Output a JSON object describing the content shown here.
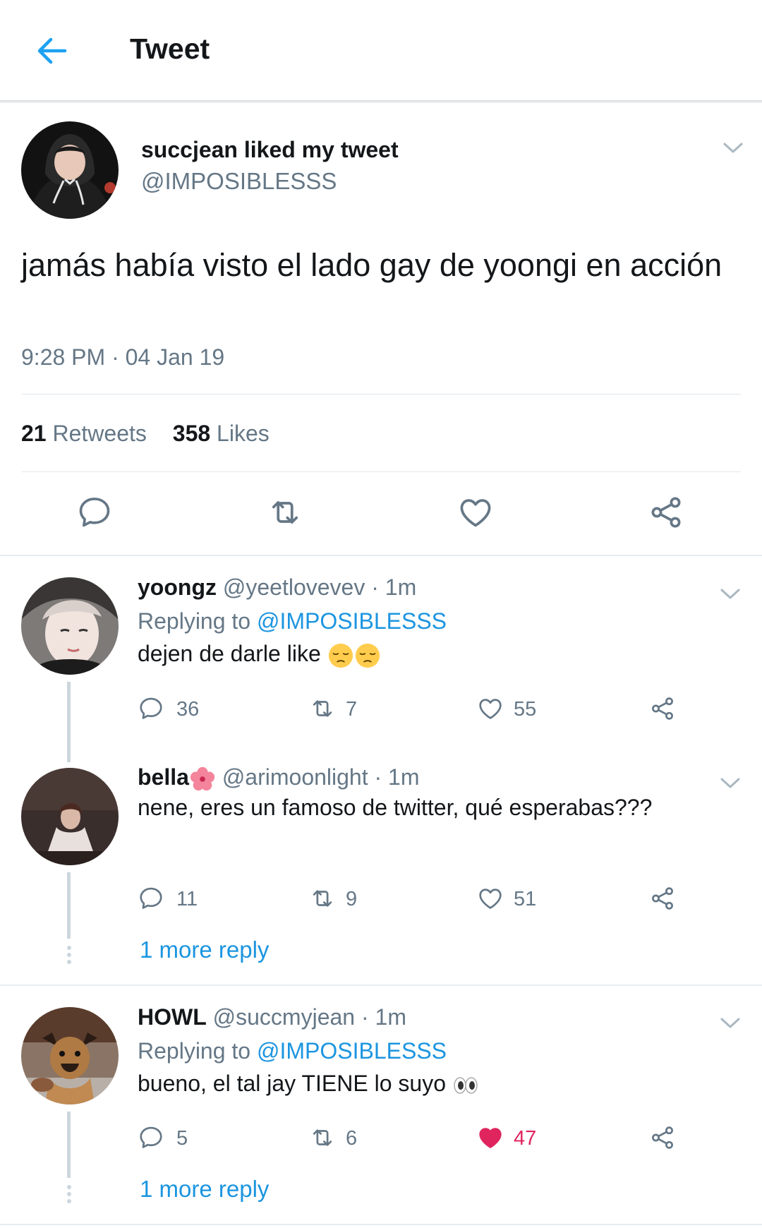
{
  "header": {
    "title": "Tweet",
    "back_icon": "back-arrow-icon"
  },
  "tweet": {
    "author_line": "succjean liked my tweet",
    "handle": "@IMPOSIBLESSS",
    "text": "jamás había visto el lado gay de yoongi en acción",
    "time": "9:28 PM · 04 Jan 19",
    "retweets_count": "21",
    "retweets_label": "Retweets",
    "likes_count": "358",
    "likes_label": "Likes"
  },
  "replies": [
    {
      "name": "yoongz",
      "handle_time": "@yeetlovevev · 1m",
      "replying_prefix": "Replying to",
      "replying_to": "@IMPOSIBLESSS",
      "text": "dejen de darle like",
      "emojis": "pensive-face-emoji x2",
      "reply_count": "36",
      "retweet_count": "7",
      "like_count": "55",
      "liked": false
    },
    {
      "name": "bella",
      "name_emoji": "hibiscus-emoji",
      "handle_time": "@arimoonlight · 1m",
      "text": "nene, eres un famoso de twitter, qué esperabas???",
      "reply_count": "11",
      "retweet_count": "9",
      "like_count": "51",
      "liked": false,
      "more_replies": "1 more reply"
    },
    {
      "name": "HOWL",
      "handle_time": "@succmyjean · 1m",
      "replying_prefix": "Replying to",
      "replying_to": "@IMPOSIBLESSS",
      "text": "bueno, el tal jay TIENE lo suyo",
      "emojis": "eyes-emoji",
      "reply_count": "5",
      "retweet_count": "6",
      "like_count": "47",
      "liked": true,
      "more_replies": "1 more reply"
    }
  ],
  "colors": {
    "accent": "#1b95e0",
    "text_primary": "#14171a",
    "text_secondary": "#657786",
    "like_active": "#e0245e",
    "divider": "#e1e8ed"
  }
}
